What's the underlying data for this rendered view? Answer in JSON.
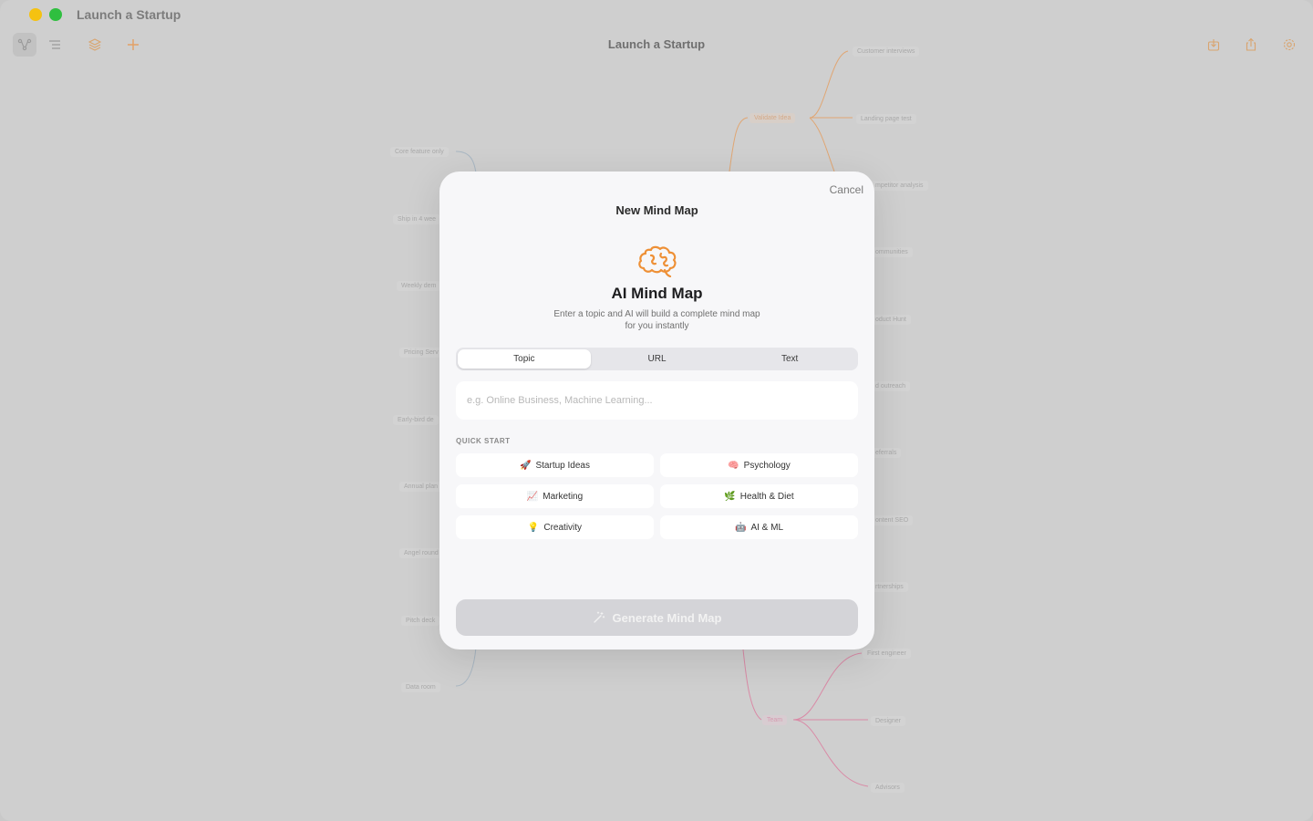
{
  "window": {
    "title": "Launch a Startup",
    "doc_title": "Launch a Startup"
  },
  "toolbar": {
    "icons": [
      "mindmap-view-icon",
      "outline-view-icon",
      "layers-icon",
      "add-icon",
      "import-icon",
      "share-icon",
      "settings-icon"
    ]
  },
  "mindmap": {
    "left_nodes": [
      "Core feature only",
      "Ship in 4 wee",
      "Weekly dem",
      "Pricing Serv",
      "Early-bird de",
      "Annual plan",
      "Angel round",
      "Pitch deck",
      "Data room"
    ],
    "right_nodes": [
      "Customer interviews",
      "Landing page test",
      "mpetitor analysis",
      "ommunities",
      "oduct Hunt",
      "d outreach",
      "eferrals",
      "ontent SEO",
      "rtnerships",
      "First engineer",
      "Designer",
      "Advisors"
    ],
    "branch_orange": "Validate Idea",
    "branch_pink": "Team"
  },
  "dialog": {
    "cancel_label": "Cancel",
    "title": "New Mind Map",
    "icon": "brain-icon",
    "heading": "AI Mind Map",
    "description": "Enter a topic and AI will build a complete mind map for you instantly",
    "tabs": [
      {
        "label": "Topic",
        "active": true
      },
      {
        "label": "URL",
        "active": false
      },
      {
        "label": "Text",
        "active": false
      }
    ],
    "input": {
      "value": "",
      "placeholder": "e.g. Online Business, Machine Learning..."
    },
    "quick_start_label": "QUICK START",
    "quick_start": [
      {
        "emoji": "🚀",
        "label": "Startup Ideas"
      },
      {
        "emoji": "🧠",
        "label": "Psychology"
      },
      {
        "emoji": "📈",
        "label": "Marketing"
      },
      {
        "emoji": "🌿",
        "label": "Health & Diet"
      },
      {
        "emoji": "💡",
        "label": "Creativity"
      },
      {
        "emoji": "🤖",
        "label": "AI & ML"
      }
    ],
    "generate_label": "Generate Mind Map",
    "generate_enabled": false
  },
  "colors": {
    "accent": "#f0913a",
    "branch_orange": "#e0a673",
    "branch_pink": "#d98aa6",
    "branch_blue": "#9fb7c7"
  }
}
